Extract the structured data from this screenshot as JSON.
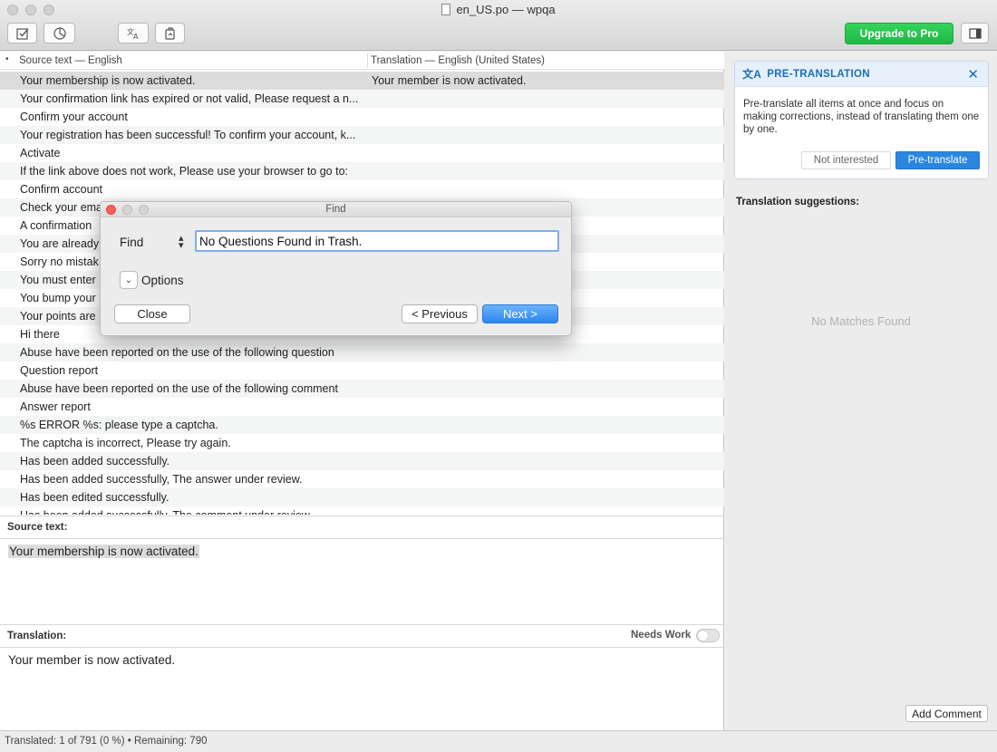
{
  "window": {
    "title": "en_US.po — wpqa"
  },
  "toolbar": {
    "upgrade_label": "Upgrade to Pro"
  },
  "list": {
    "header_dot": "•",
    "source_header": "Source text — English",
    "translation_header": "Translation — English (United States)",
    "rows": [
      {
        "source": "Your membership is now activated.",
        "translation": "Your member is now activated."
      },
      {
        "source": "Your confirmation link has expired or not valid, Please request a n...",
        "translation": ""
      },
      {
        "source": "Confirm your account",
        "translation": ""
      },
      {
        "source": "Your registration has been successful! To confirm your account, k...",
        "translation": ""
      },
      {
        "source": "Activate",
        "translation": ""
      },
      {
        "source": "If the link above does not work, Please use your browser to go to:",
        "translation": ""
      },
      {
        "source": "Confirm account",
        "translation": ""
      },
      {
        "source": "Check your ema",
        "translation": ""
      },
      {
        "source": "A confirmation",
        "translation": ""
      },
      {
        "source": "You are already",
        "translation": ""
      },
      {
        "source": "Sorry no mistak",
        "translation": ""
      },
      {
        "source": "You must enter",
        "translation": ""
      },
      {
        "source": "You bump your",
        "translation": ""
      },
      {
        "source": "Your points are",
        "translation": ""
      },
      {
        "source": "Hi there",
        "translation": ""
      },
      {
        "source": "Abuse have been reported on the use of the following question",
        "translation": ""
      },
      {
        "source": "Question report",
        "translation": ""
      },
      {
        "source": "Abuse have been reported on the use of the following comment",
        "translation": ""
      },
      {
        "source": "Answer report",
        "translation": ""
      },
      {
        "source": "%s ERROR %s: please type a captcha.",
        "translation": ""
      },
      {
        "source": "The captcha is incorrect, Please try again.",
        "translation": ""
      },
      {
        "source": "Has been added successfully.",
        "translation": ""
      },
      {
        "source": "Has been added successfully, The answer under review.",
        "translation": ""
      },
      {
        "source": "Has been edited successfully.",
        "translation": ""
      },
      {
        "source": "Has been added successfully, The comment under review.",
        "translation": ""
      }
    ]
  },
  "editor": {
    "source_label": "Source text:",
    "source_value": "Your membership is now activated.",
    "translation_label": "Translation:",
    "needs_work_label": "Needs Work",
    "translation_value": "Your member is now activated."
  },
  "pretranslation": {
    "title": "PRE-TRANSLATION",
    "body": "Pre-translate all items at once and focus on making corrections, instead of translating them one by one.",
    "not_interested_label": "Not interested",
    "pretranslate_label": "Pre-translate"
  },
  "suggestions": {
    "label": "Translation suggestions:",
    "empty": "No Matches Found",
    "add_comment_label": "Add Comment"
  },
  "status": {
    "text": "Translated: 1 of 791 (0 %)  •  Remaining: 790"
  },
  "find_dialog": {
    "title": "Find",
    "find_label": "Find",
    "query": "No Questions Found in Trash.",
    "options_label": "Options",
    "close_label": "Close",
    "previous_label": "< Previous",
    "next_label": "Next >"
  }
}
